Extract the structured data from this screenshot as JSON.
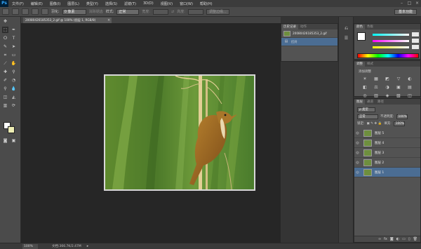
{
  "app": {
    "logo": "Ps",
    "menu": [
      "文件(F)",
      "编辑(E)",
      "图像(I)",
      "图层(L)",
      "类型(Y)",
      "选择(S)",
      "滤镜(T)",
      "3D(D)",
      "视图(V)",
      "窗口(W)",
      "帮助(H)"
    ],
    "window_controls": [
      "–",
      "□",
      "×"
    ]
  },
  "options_bar": {
    "feather_label": "羽化:",
    "feather_value": "0 像素",
    "antialias_label": "消除锯齿",
    "style_label": "样式:",
    "style_value": "正常",
    "width_label": "宽度:",
    "height_label": "高度:",
    "refine_edge": "调整边缘...",
    "workspace": "基本功能"
  },
  "document": {
    "tab_title": "20080426185353_2.gif @ 100% (图层 1, RGB/8)",
    "tab_close": "×"
  },
  "status": {
    "zoom": "100%",
    "doc_info": "文档:366.7K/2.47M",
    "arrow": "▸"
  },
  "history": {
    "tabs": [
      "历史记录",
      "动作"
    ],
    "snapshot_name": "20080426185353_2.gif",
    "step_name": "打开"
  },
  "color_panel": {
    "tabs": [
      "颜色",
      "色板"
    ]
  },
  "adjustments": {
    "tabs": [
      "调整",
      "样式"
    ],
    "label": "添加调整",
    "icons": [
      "☀",
      "▦",
      "◩",
      "▽",
      "◐",
      "◧",
      "⚖",
      "◑",
      "▣",
      "▤",
      "◎",
      "▥",
      "◈",
      "▧",
      "◫"
    ]
  },
  "layers": {
    "tabs": [
      "图层",
      "通道",
      "路径"
    ],
    "filter_label": "ρ 类型",
    "blend_mode": "正常",
    "opacity_label": "不透明度:",
    "opacity_value": "100%",
    "lock_label": "锁定:",
    "fill_label": "填充:",
    "fill_value": "100%",
    "items": [
      {
        "name": "图层 5",
        "selected": false
      },
      {
        "name": "图层 4",
        "selected": false
      },
      {
        "name": "图层 3",
        "selected": false
      },
      {
        "name": "图层 2",
        "selected": false
      },
      {
        "name": "图层 1",
        "selected": true
      }
    ],
    "footer_icons": [
      "∞",
      "fx",
      "◙",
      "◐",
      "▭",
      "▯",
      "🗑"
    ]
  },
  "colors": {
    "accent_selection": "#4b6d93",
    "foreground": "#ffffff",
    "background": "#eeeeb4"
  }
}
